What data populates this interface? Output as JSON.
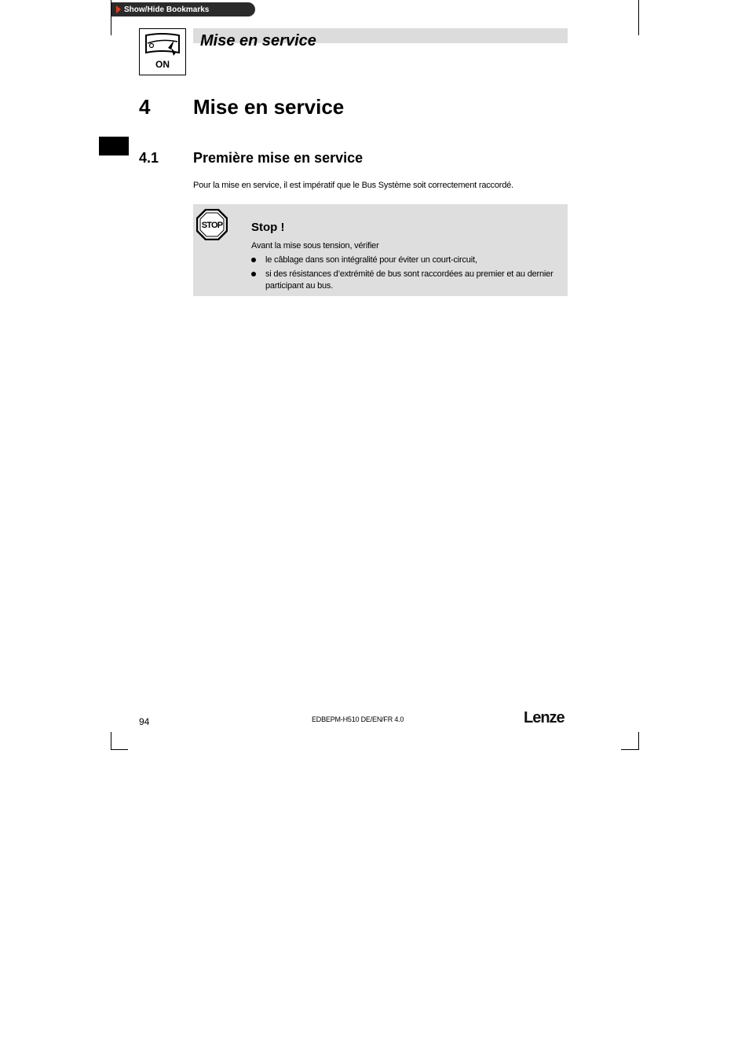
{
  "bookmark": {
    "label": "Show/Hide Bookmarks"
  },
  "header": {
    "icon_label": "ON",
    "title": "Mise en service"
  },
  "section": {
    "number": "4",
    "title": "Mise en service"
  },
  "subsection": {
    "number": "4.1",
    "title": "Première mise en service",
    "intro": "Pour la mise en service, il est impératif que le Bus Système soit correctement raccordé."
  },
  "stop_note": {
    "icon_text": "STOP",
    "title": "Stop !",
    "lead": "Avant la mise sous tension, vérifier",
    "items": [
      "le câblage dans son intégralité pour éviter un court-circuit,",
      "si des résistances d’extrémité de bus sont raccordées au premier et au dernier participant au bus."
    ]
  },
  "footer": {
    "page_number": "94",
    "doc_code": "EDBEPM-H510 DE/EN/FR 4.0",
    "brand": "Lenze"
  }
}
